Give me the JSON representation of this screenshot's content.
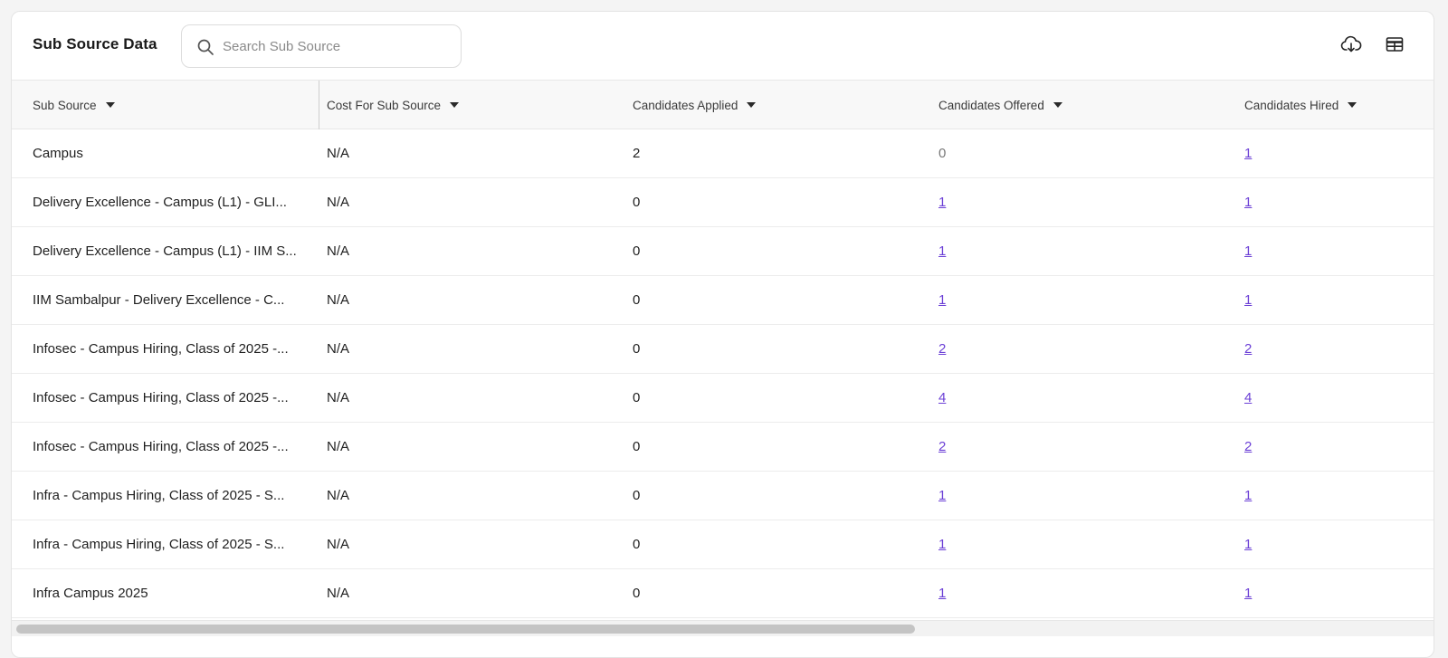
{
  "header": {
    "title": "Sub Source Data",
    "search_placeholder": "Search Sub Source"
  },
  "columns": [
    {
      "label": "Sub Source"
    },
    {
      "label": "Cost For Sub Source"
    },
    {
      "label": "Candidates Applied"
    },
    {
      "label": "Candidates Offered"
    },
    {
      "label": "Candidates Hired"
    }
  ],
  "rows": [
    {
      "sub_source": "Campus",
      "cost": "N/A",
      "applied": "2",
      "offered": "0",
      "hired": "1"
    },
    {
      "sub_source": "Delivery Excellence - Campus (L1) - GLI...",
      "cost": "N/A",
      "applied": "0",
      "offered": "1",
      "hired": "1"
    },
    {
      "sub_source": "Delivery Excellence - Campus (L1) - IIM S...",
      "cost": "N/A",
      "applied": "0",
      "offered": "1",
      "hired": "1"
    },
    {
      "sub_source": "IIM Sambalpur - Delivery Excellence - C...",
      "cost": "N/A",
      "applied": "0",
      "offered": "1",
      "hired": "1"
    },
    {
      "sub_source": "Infosec - Campus Hiring, Class of 2025 -...",
      "cost": "N/A",
      "applied": "0",
      "offered": "2",
      "hired": "2"
    },
    {
      "sub_source": "Infosec - Campus Hiring, Class of 2025 -...",
      "cost": "N/A",
      "applied": "0",
      "offered": "4",
      "hired": "4"
    },
    {
      "sub_source": "Infosec - Campus Hiring, Class of 2025 -...",
      "cost": "N/A",
      "applied": "0",
      "offered": "2",
      "hired": "2"
    },
    {
      "sub_source": "Infra - Campus Hiring, Class of 2025 - S...",
      "cost": "N/A",
      "applied": "0",
      "offered": "1",
      "hired": "1"
    },
    {
      "sub_source": "Infra - Campus Hiring, Class of 2025 - S...",
      "cost": "N/A",
      "applied": "0",
      "offered": "1",
      "hired": "1"
    },
    {
      "sub_source": "Infra Campus 2025",
      "cost": "N/A",
      "applied": "0",
      "offered": "1",
      "hired": "1"
    }
  ],
  "colors": {
    "link": "#6b3fd6",
    "header_bg": "#f8f8f8",
    "muted_zero": "#777777"
  },
  "icons": {
    "search": "search-icon",
    "download": "cloud-download-icon",
    "columns": "table-columns-icon",
    "sort": "caret-down-icon"
  }
}
